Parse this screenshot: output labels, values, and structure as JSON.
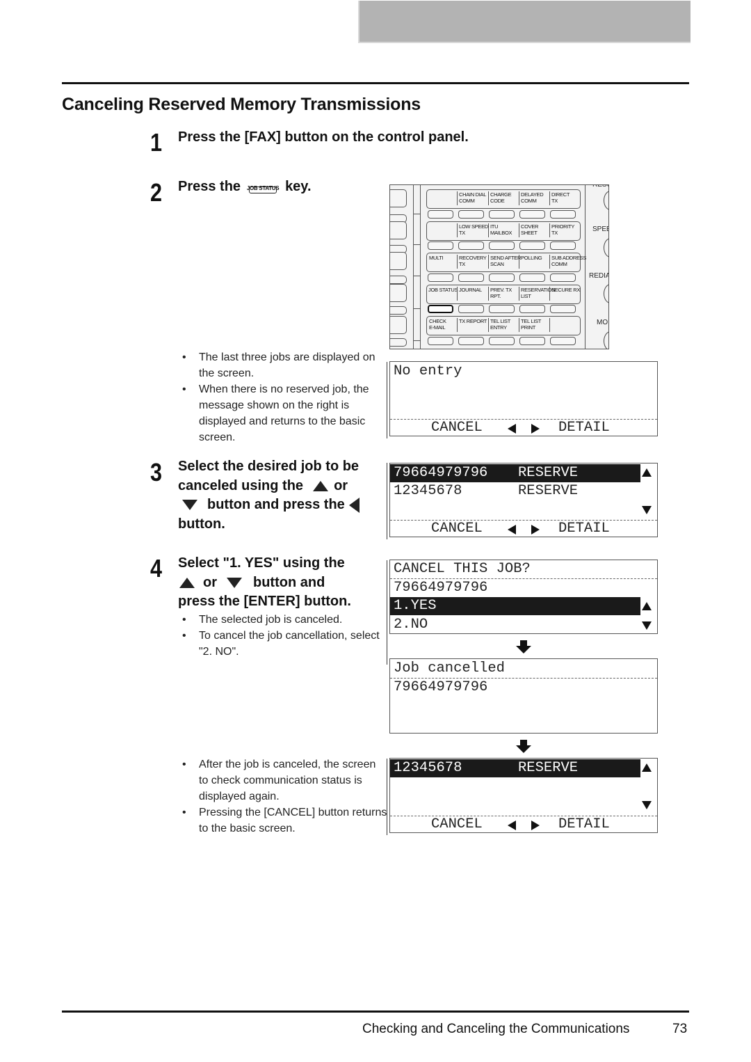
{
  "page": {
    "title": "Canceling Reserved Memory Transmissions",
    "footer": {
      "section": "Checking and Canceling the Communications",
      "page_number": "73"
    }
  },
  "steps": [
    {
      "number": "1",
      "text": "Press the [FAX] button on the control panel."
    },
    {
      "number": "2",
      "text_before": "Press the",
      "key_label": "JOB STATUS",
      "text_after": "key.",
      "notes": [
        "The last three jobs are displayed on the screen.",
        "When there is no reserved job, the message shown on the right is displayed and returns to the basic screen."
      ]
    },
    {
      "number": "3",
      "line1": "Select the desired job to be",
      "line2_a": "canceled using the",
      "line2_b": "or",
      "line3": "button and press the",
      "line4": "button."
    },
    {
      "number": "4",
      "line1": "Select \"1. YES\" using the",
      "line2_a": "or",
      "line2_b": "button and",
      "line3": "press the [ENTER] button.",
      "notes": [
        "The selected job is canceled.",
        "To cancel the job cancellation, select \"2. NO\"."
      ]
    },
    {
      "notes": [
        "After the job is canceled, the screen to check communication status is displayed again.",
        "Pressing the [CANCEL] button returns to the basic screen."
      ]
    }
  ],
  "control_panel": {
    "rows": [
      {
        "cells": [
          "",
          "CHAIN DIAL\nCOMM",
          "CHARGE\nCODE",
          "DELAYED\nCOMM",
          "DIRECT\nTX"
        ]
      },
      {
        "cells": [
          "",
          "LOW SPEED\nTX",
          "ITU\nMAILBOX",
          "COVER\nSHEET",
          "PRIORITY\nTX"
        ]
      },
      {
        "cells": [
          "MULTI",
          "RECOVERY\nTX",
          "SEND AFTER\nSCAN",
          "POLLING",
          "SUB ADDRESS\nCOMM"
        ]
      },
      {
        "cells": [
          "JOB STATUS",
          "JOURNAL",
          "PREV. TX\nRPT.",
          "RESERVATION\nLIST",
          "SECURE RX"
        ]
      },
      {
        "cells": [
          "CHECK\nE-MAIL",
          "TX REPORT",
          "TEL LIST\nENTRY",
          "TEL LIST\nPRINT",
          ""
        ]
      }
    ],
    "highlighted_key": "JOB STATUS",
    "side_labels": [
      "RESO",
      "SPEE",
      "REDIA",
      "MO"
    ]
  },
  "screens": {
    "softkeys": {
      "cancel": "CANCEL",
      "detail": "DETAIL"
    },
    "no_entry": {
      "line1": "No entry"
    },
    "job_list": {
      "rows": [
        {
          "number": "79664979796",
          "status": "RESERVE",
          "selected": true
        },
        {
          "number": "12345678",
          "status": "RESERVE",
          "selected": false
        }
      ]
    },
    "confirm": {
      "title": "CANCEL THIS JOB?",
      "number": "79664979796",
      "options": [
        {
          "label": "1.YES",
          "selected": true
        },
        {
          "label": "2.NO",
          "selected": false
        }
      ]
    },
    "cancelled": {
      "title": "Job cancelled",
      "number": "79664979796"
    },
    "job_list_after": {
      "rows": [
        {
          "number": "12345678",
          "status": "RESERVE",
          "selected": true
        }
      ]
    }
  }
}
